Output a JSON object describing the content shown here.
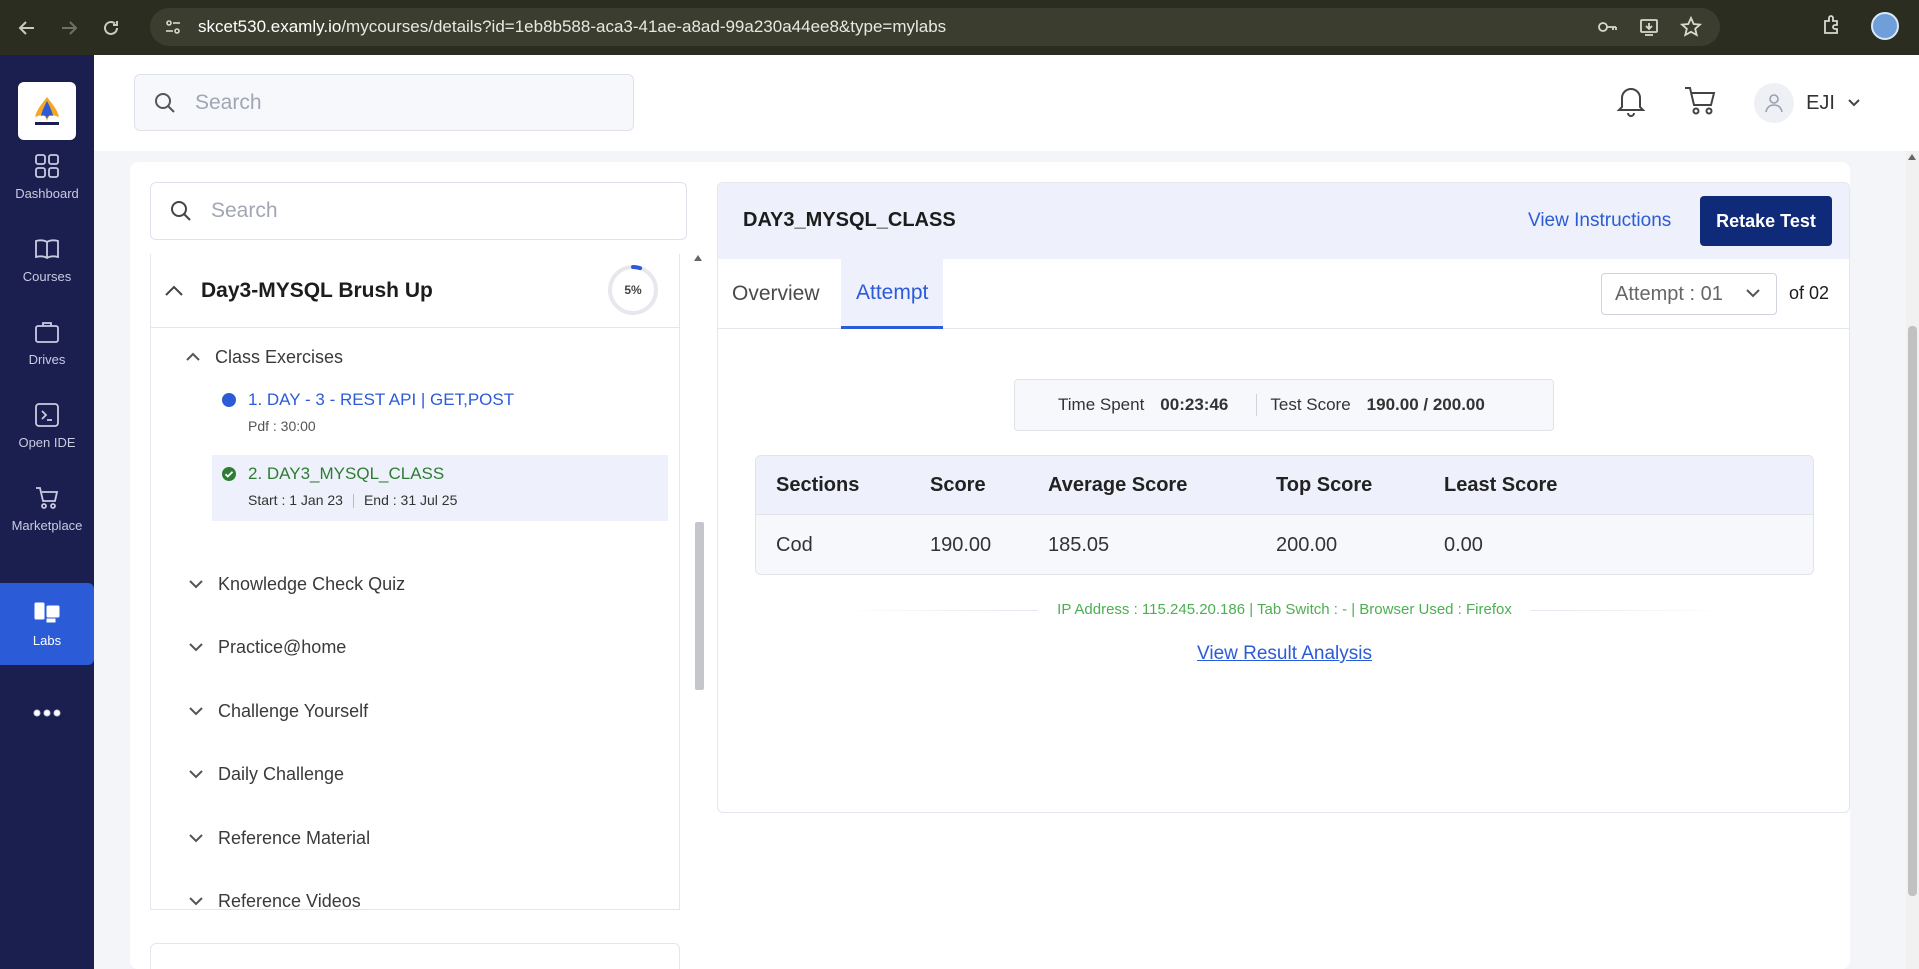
{
  "browser": {
    "url_host": "skcet530.examly.io",
    "url_path": "/mycourses/details?id=1eb8b588-aca3-41ae-a8ad-99a230a44ee8&type=mylabs"
  },
  "rail": {
    "items": [
      {
        "label": "Dashboard",
        "icon": "grid-icon"
      },
      {
        "label": "Courses",
        "icon": "book-icon"
      },
      {
        "label": "Drives",
        "icon": "briefcase-icon"
      },
      {
        "label": "Open IDE",
        "icon": "terminal-icon"
      },
      {
        "label": "Marketplace",
        "icon": "cart-icon"
      },
      {
        "label": "Labs",
        "icon": "labs-icon",
        "active": true
      }
    ]
  },
  "header": {
    "search_placeholder": "Search",
    "user_name": "EJI"
  },
  "sidebar": {
    "search_placeholder": "Search",
    "module_title": "Day3-MYSQL Brush Up",
    "module_progress_label": "5%",
    "module_progress": 0.05,
    "sections": [
      {
        "label": "Class Exercises",
        "expanded": true
      },
      {
        "label": "Knowledge Check Quiz"
      },
      {
        "label": "Practice@home"
      },
      {
        "label": "Challenge Yourself"
      },
      {
        "label": "Daily Challenge"
      },
      {
        "label": "Reference Material"
      },
      {
        "label": "Reference Videos"
      }
    ],
    "items": [
      {
        "title": "1. DAY - 3 - REST API | GET,POST",
        "sub": "Pdf : 30:00",
        "color": "#2b5bd7"
      },
      {
        "title": "2. DAY3_MYSQL_CLASS",
        "start": "Start : 1 Jan 23",
        "end": "End : 31 Jul 25",
        "color": "#2e7d32"
      }
    ]
  },
  "detail": {
    "title": "DAY3_MYSQL_CLASS",
    "view_instructions": "View Instructions",
    "retake_label": "Retake Test",
    "tabs": [
      "Overview",
      "Attempt"
    ],
    "active_tab": "Attempt",
    "attempt_value": "Attempt : 01",
    "attempt_of": "of 02",
    "time_spent_label": "Time Spent",
    "time_spent": "00:23:46",
    "test_score_label": "Test Score",
    "test_score": "190.00 / 200.00",
    "table": {
      "headers": [
        "Sections",
        "Score",
        "Average Score",
        "Top Score",
        "Least Score"
      ],
      "rows": [
        [
          "Cod",
          "190.00",
          "185.05",
          "200.00",
          "0.00"
        ]
      ]
    },
    "ip_line": "IP Address : 115.245.20.186 | Tab Switch : - | Browser Used : Firefox",
    "view_result": "View Result Analysis"
  },
  "colors": {
    "rail_bg": "#1b1f4f",
    "accent": "#2b5bd7",
    "retake_bg": "#102a7a",
    "success": "#2e7d32",
    "ip_green": "#4caf50"
  }
}
